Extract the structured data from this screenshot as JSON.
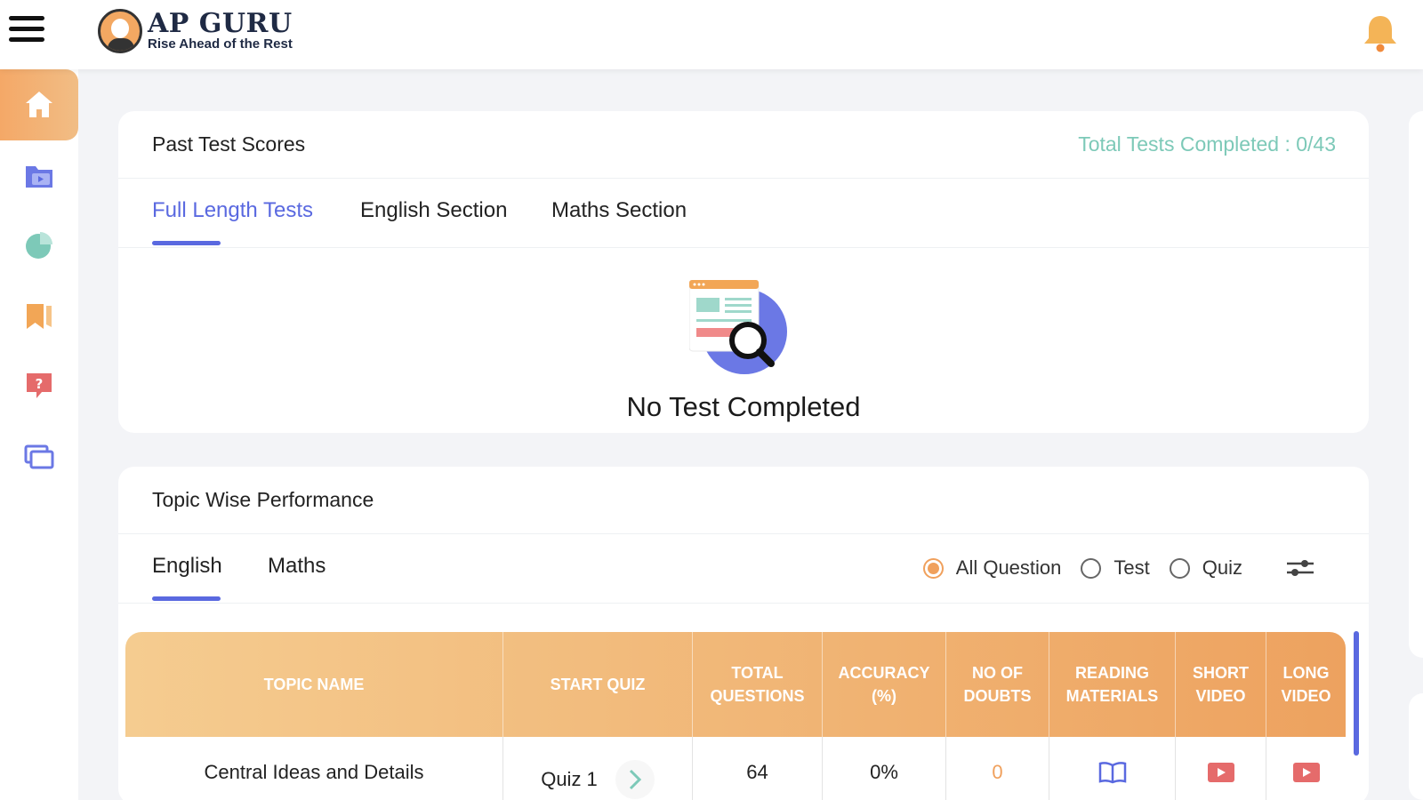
{
  "header": {
    "logo_title": "AP GURU",
    "logo_subtitle": "Rise Ahead of the Rest"
  },
  "sidebar": {
    "items": [
      {
        "icon": "home-icon",
        "active": true
      },
      {
        "icon": "video-folder-icon",
        "active": false
      },
      {
        "icon": "pie-chart-icon",
        "active": false
      },
      {
        "icon": "bookmark-icon",
        "active": false
      },
      {
        "icon": "question-chat-icon",
        "active": false
      },
      {
        "icon": "screens-icon",
        "active": false
      }
    ]
  },
  "past_scores": {
    "title": "Past Test Scores",
    "total_completed": "Total Tests Completed : 0/43",
    "tabs": [
      "Full Length Tests",
      "English Section",
      "Maths Section"
    ],
    "active_tab": 0,
    "empty_message": "No Test Completed"
  },
  "topic_performance": {
    "title": "Topic Wise Performance",
    "tabs": [
      "English",
      "Maths"
    ],
    "active_tab": 0,
    "filters": [
      "All Question",
      "Test",
      "Quiz"
    ],
    "selected_filter": 0,
    "columns": [
      "TOPIC NAME",
      "START QUIZ",
      "TOTAL QUESTIONS",
      "ACCURACY (%)",
      "NO OF DOUBTS",
      "READING MATERIALS",
      "SHORT VIDEO",
      "LONG VIDEO"
    ],
    "rows": [
      {
        "topic": "Central Ideas and Details",
        "quiz": "Quiz 1",
        "total_questions": "64",
        "accuracy": "0%",
        "doubts": "0"
      }
    ]
  },
  "colors": {
    "accent_purple": "#5a69e0",
    "accent_orange": "#f0a05c",
    "teal": "#7dc9b8"
  }
}
